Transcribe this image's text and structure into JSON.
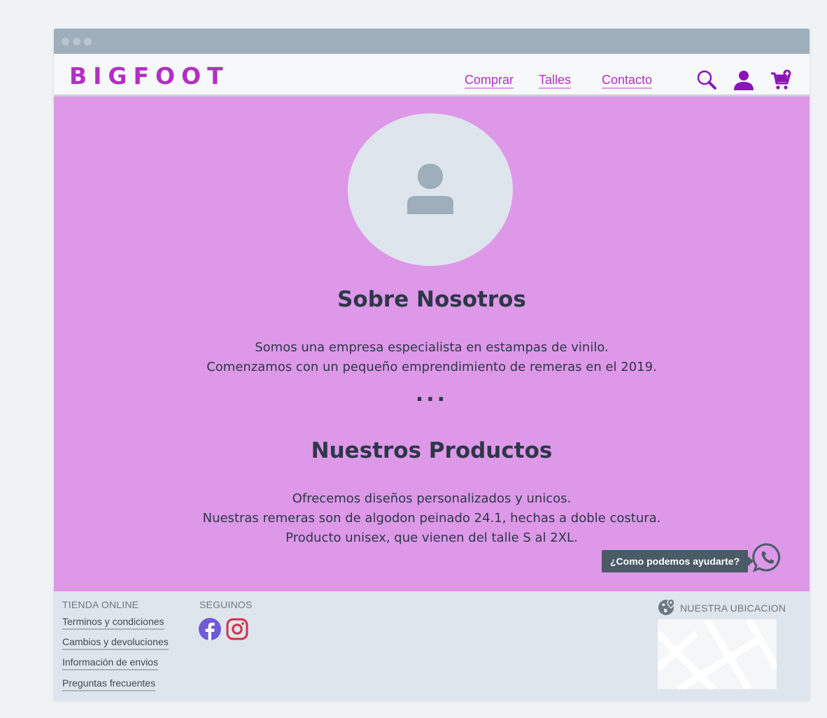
{
  "brand": {
    "logo": "BIGFOOT",
    "accent": "#b130c4",
    "hero_bg": "#dd98e8"
  },
  "nav": {
    "links": [
      {
        "label": "Comprar"
      },
      {
        "label": "Talles"
      },
      {
        "label": "Contacto"
      }
    ],
    "icons": [
      "search-icon",
      "user-icon",
      "cart-icon"
    ]
  },
  "about": {
    "title": "Sobre Nosotros",
    "lines": [
      "Somos una empresa especialista en estampas de vinilo.",
      "Comenzamos con un pequeño emprendimiento de remeras en el 2019."
    ],
    "ellipsis": "..."
  },
  "products": {
    "title": "Nuestros Productos",
    "lines": [
      "Ofrecemos diseños personalizados y unicos.",
      "Nuestras remeras son de algodon peinado 24.1, hechas a doble costura.",
      "Producto unisex, que vienen del talle S al 2XL."
    ]
  },
  "chat": {
    "prompt": "¿Como podemos ayudarte?",
    "icon": "whatsapp-icon"
  },
  "footer": {
    "store": {
      "heading": "TIENDA ONLINE",
      "links": [
        "Terminos y condiciones",
        "Cambios y devoluciones",
        "Información de envios",
        "Preguntas frecuentes"
      ]
    },
    "follow": {
      "heading": "SEGUINOS",
      "icons": [
        "facebook-icon",
        "instagram-icon"
      ]
    },
    "location": {
      "heading": "NUESTRA UBICACION",
      "icon": "globe-pin-icon"
    }
  }
}
